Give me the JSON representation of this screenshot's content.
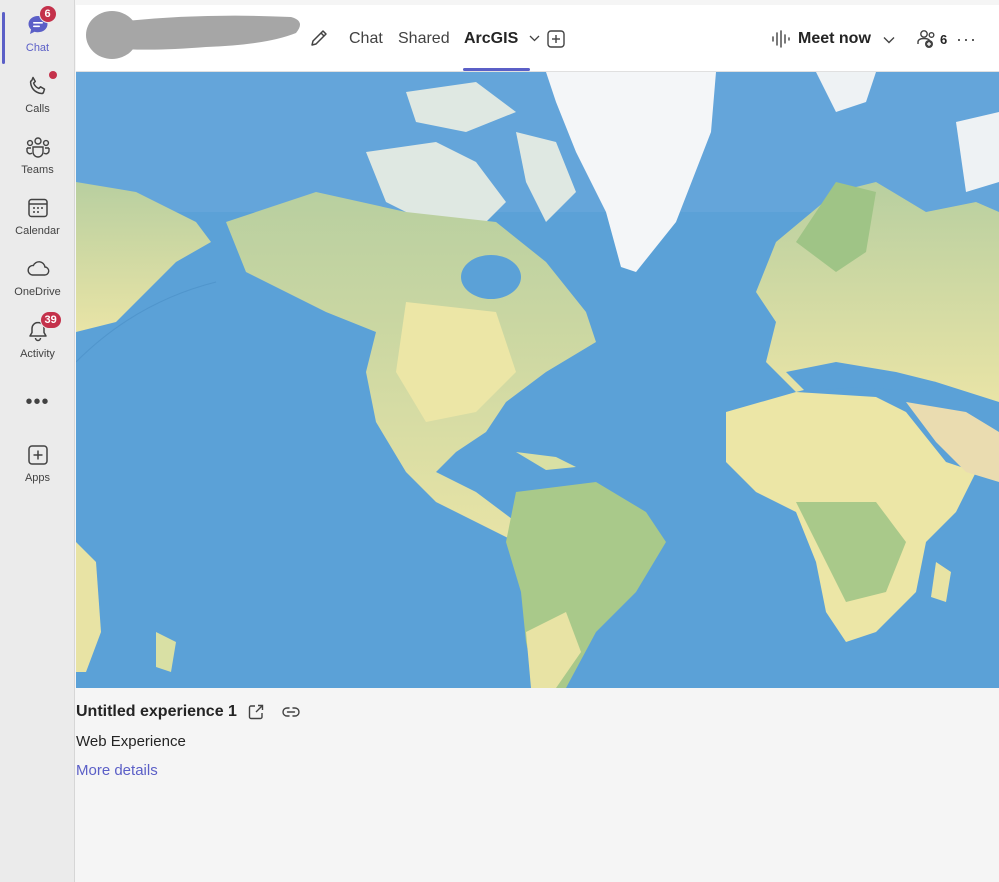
{
  "rail": {
    "items": [
      {
        "label": "Chat",
        "badge": "6"
      },
      {
        "label": "Calls"
      },
      {
        "label": "Teams"
      },
      {
        "label": "Calendar"
      },
      {
        "label": "OneDrive"
      },
      {
        "label": "Activity",
        "badge": "39"
      },
      {
        "label": "Apps"
      }
    ],
    "more": "•••",
    "accent": "#5b5fc7",
    "badge_color": "#c4314b"
  },
  "header": {
    "tabs": [
      {
        "label": "Chat"
      },
      {
        "label": "Shared"
      },
      {
        "label": "ArcGIS"
      }
    ],
    "meet_label": "Meet now",
    "people_count": "6",
    "more": "···"
  },
  "card": {
    "title": "Untitled experience 1",
    "subtitle": "Web Experience",
    "link": "More details"
  },
  "colors": {
    "ocean": "#5aa0d6",
    "land": "#e8e6a8",
    "forest": "#a9c98a",
    "ice": "#f4f6f8"
  }
}
